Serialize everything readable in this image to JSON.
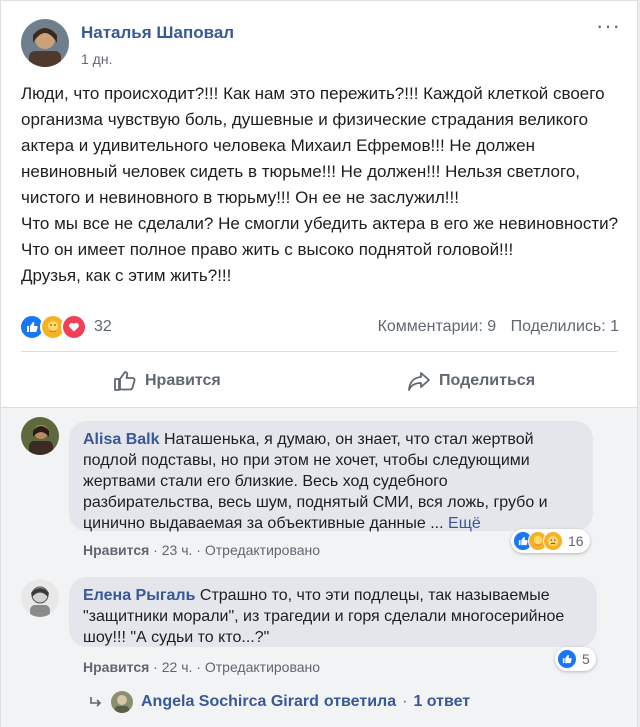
{
  "post": {
    "author": "Наталья Шаповал",
    "time": "1 дн.",
    "text": "Люди, что происходит?!!! Как нам это пережить?!!! Каждой клеткой своего организма чувствую боль, душевные и физические страдания великого актера и удивительного человека Михаил Ефремов!!! Не должен невиновный человек сидеть в тюрьме!!! Не должен!!! Нельзя светлого, чистого и невиновного в тюрьму!!! Он ее не заслужил!!!\nЧто мы все не сделали? Не смогли убедить актера в его же невиновности? Что он имеет полное право жить с высоко поднятой головой!!!\nДрузья, как с этим жить?!!!",
    "reactions_count": "32",
    "comments_label": "Комментарии: 9",
    "shares_label": "Поделились: 1",
    "more_label": "···"
  },
  "actions": {
    "like": "Нравится",
    "share": "Поделиться"
  },
  "comments": [
    {
      "author": "Alisa Balk",
      "text": "Наташенька, я думаю, он знает, что стал жертвой подлой подставы, но при этом не хочет, чтобы следующими жертвами стали его близкие. Весь ход судебного разбирательства, весь шум, поднятый СМИ, вся ложь, грубо и цинично выдаваемая за объективные данные ... ",
      "see_more": "Ещё",
      "like": "Нравится",
      "time": "23 ч.",
      "edited": "Отредактировано",
      "reactions": "16"
    },
    {
      "author": "Елена Рыгаль",
      "text": "Страшно то, что эти подлецы, так называемые \"защитники морали\", из трагедии и горя сделали многосерийное шоу!!! \"А судьи то кто...?\"",
      "like": "Нравится",
      "time": "22 ч.",
      "edited": "Отредактировано",
      "reactions": "5"
    }
  ],
  "reply": {
    "author": "Angela Sochirca Girard",
    "verb": "ответила",
    "count": "1 ответ"
  },
  "colors": {
    "link": "#385898",
    "muted": "#606770",
    "like_blue": "#1877f2",
    "love_red": "#f33e58",
    "care_yellow": "#f7b125"
  }
}
